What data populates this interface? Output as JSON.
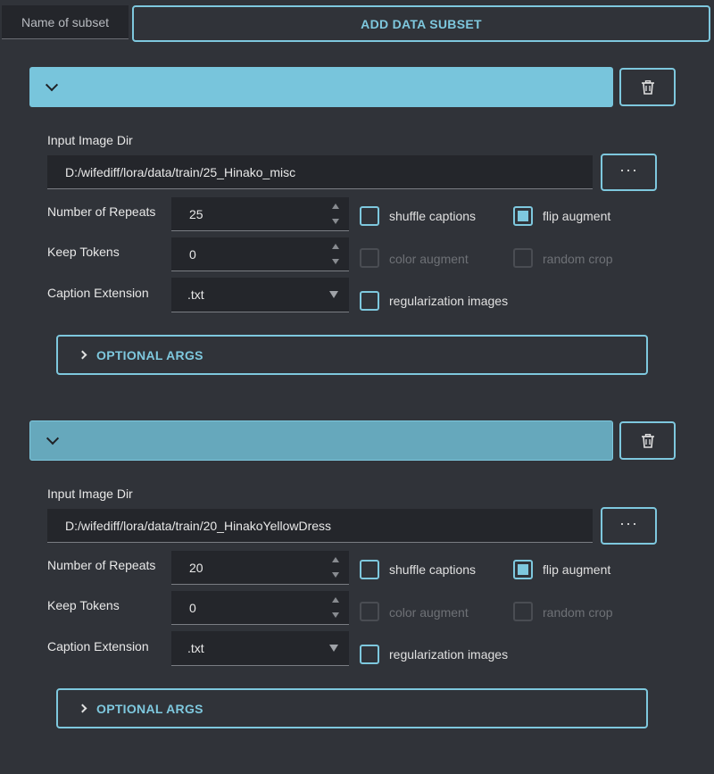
{
  "top": {
    "name_placeholder": "Name of subset",
    "add_label": "ADD DATA SUBSET"
  },
  "labels": {
    "input_dir": "Input Image Dir",
    "repeats": "Number of Repeats",
    "keep_tokens": "Keep Tokens",
    "caption_ext": "Caption Extension",
    "browse": "···",
    "shuffle": "shuffle captions",
    "flip": "flip augment",
    "color": "color augment",
    "random_crop": "random crop",
    "regularization": "regularization images",
    "optional_args": "OPTIONAL ARGS"
  },
  "subsets": [
    {
      "input_dir": "D:/wifediff/lora/data/train/25_Hinako_misc",
      "repeats": "25",
      "keep_tokens": "0",
      "caption_ext": ".txt"
    },
    {
      "input_dir": "D:/wifediff/lora/data/train/20_HinakoYellowDress",
      "repeats": "20",
      "keep_tokens": "0",
      "caption_ext": ".txt"
    }
  ],
  "colors": {
    "accent": "#7ec8de",
    "background": "#303339",
    "field": "#24262b"
  }
}
